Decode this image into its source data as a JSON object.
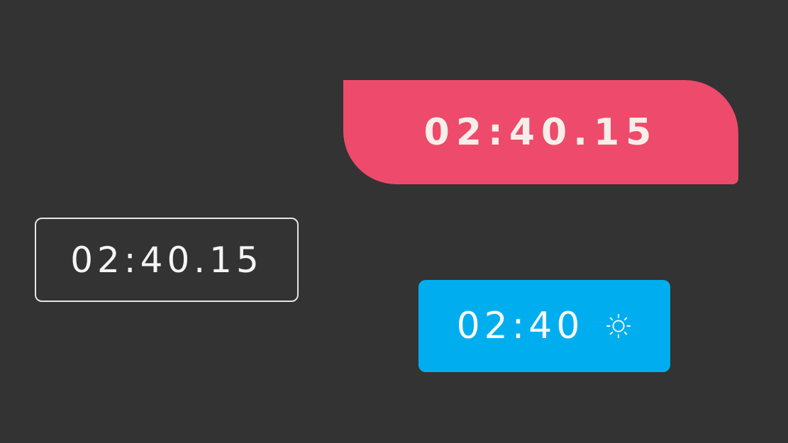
{
  "timers": {
    "outline": {
      "time": "02:40.15"
    },
    "red": {
      "time": "02:40.15",
      "color": "#ee4a6b"
    },
    "blue": {
      "time": "02:40",
      "color": "#00aeef",
      "icon": "sun-icon"
    }
  },
  "background": "#333333"
}
